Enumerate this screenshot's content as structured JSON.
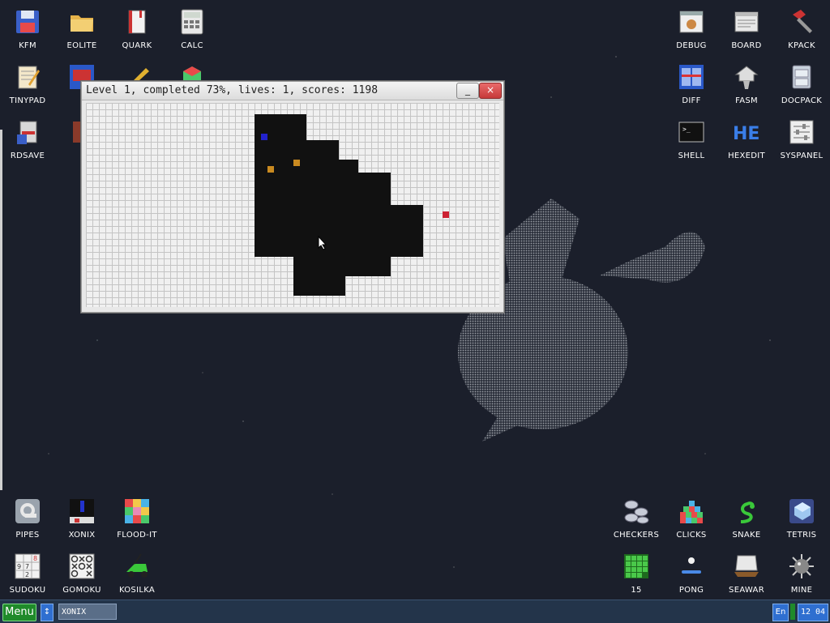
{
  "desktop": {
    "icons_top_left": [
      {
        "label": "KFM",
        "icon": "floppy-icon"
      },
      {
        "label": "EOLITE",
        "icon": "folder-icon"
      },
      {
        "label": "QUARK",
        "icon": "notebook-icon"
      },
      {
        "label": "CALC",
        "icon": "calculator-icon"
      },
      {
        "label": "TINYPAD",
        "icon": "notepad-icon"
      },
      {
        "label": "RDSAVE",
        "icon": "ramdisk-save-icon"
      }
    ],
    "icons_top_right": [
      {
        "label": "DEBUG",
        "icon": "debug-icon"
      },
      {
        "label": "BOARD",
        "icon": "board-icon"
      },
      {
        "label": "KPACK",
        "icon": "hammer-icon"
      },
      {
        "label": "DIFF",
        "icon": "diff-icon"
      },
      {
        "label": "FASM",
        "icon": "fasm-icon"
      },
      {
        "label": "DOCPACK",
        "icon": "docpack-icon"
      },
      {
        "label": "SHELL",
        "icon": "terminal-icon"
      },
      {
        "label": "HEXEDIT",
        "icon": "hex-icon"
      },
      {
        "label": "SYSPANEL",
        "icon": "sliders-icon"
      }
    ],
    "icons_bottom_left": [
      {
        "label": "PIPES",
        "icon": "pipes-icon"
      },
      {
        "label": "XONIX",
        "icon": "xonix-icon"
      },
      {
        "label": "FLOOD-IT",
        "icon": "flood-it-icon"
      },
      {
        "label": "SUDOKU",
        "icon": "sudoku-icon"
      },
      {
        "label": "GOMOKU",
        "icon": "gomoku-icon"
      },
      {
        "label": "KOSILKA",
        "icon": "lawnmower-icon"
      }
    ],
    "icons_bottom_right": [
      {
        "label": "CHECKERS",
        "icon": "checkers-icon"
      },
      {
        "label": "CLICKS",
        "icon": "clicks-icon"
      },
      {
        "label": "SNAKE",
        "icon": "snake-icon"
      },
      {
        "label": "TETRIS",
        "icon": "tetris-icon"
      },
      {
        "label": "15",
        "icon": "fifteen-icon"
      },
      {
        "label": "PONG",
        "icon": "pong-icon"
      },
      {
        "label": "SEAWAR",
        "icon": "seawar-icon"
      },
      {
        "label": "MINE",
        "icon": "mine-icon"
      }
    ]
  },
  "window": {
    "title": "Level 1, completed 73%, lives: 1, scores: 1198",
    "minimize_label": "_",
    "close_label": "×"
  },
  "taskbar": {
    "menu_label": "Menu",
    "switch_label": "↕",
    "task_label": "XONIX",
    "lang_label": "En",
    "clock": "12 04"
  },
  "colors": {
    "desktop_bg": "#1b1f2b",
    "taskbar_bg": "#23344a",
    "menu_green": "#1f8a2a",
    "tray_blue": "#2f6fd0",
    "player_blue": "#2222cc",
    "enemy_orange": "#c98a20",
    "enemy_red": "#cc2233"
  }
}
